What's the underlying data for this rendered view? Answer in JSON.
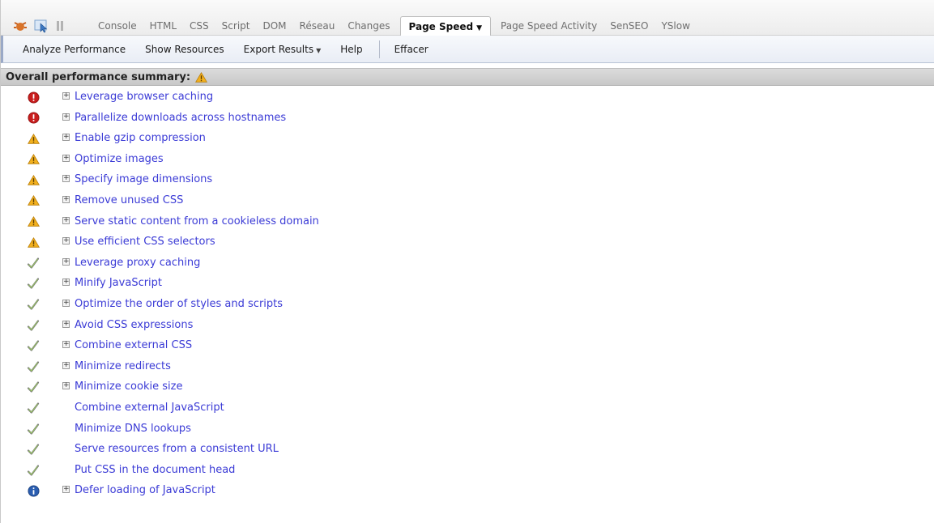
{
  "toolbar_tabs": {
    "tabs": [
      {
        "label": "Console",
        "active": false
      },
      {
        "label": "HTML",
        "active": false
      },
      {
        "label": "CSS",
        "active": false
      },
      {
        "label": "Script",
        "active": false
      },
      {
        "label": "DOM",
        "active": false
      },
      {
        "label": "Réseau",
        "active": false
      },
      {
        "label": "Changes",
        "active": false
      },
      {
        "label": "Page Speed",
        "active": true
      },
      {
        "label": "Page Speed Activity",
        "active": false
      },
      {
        "label": "SenSEO",
        "active": false
      },
      {
        "label": "YSlow",
        "active": false
      }
    ]
  },
  "actions": {
    "analyze": "Analyze Performance",
    "show_resources": "Show Resources",
    "export_results": "Export Results",
    "help": "Help",
    "clear": "Effacer"
  },
  "summary": {
    "label": "Overall performance summary:",
    "status_icon": "warning-icon"
  },
  "colors": {
    "link": "#3b3bd6",
    "error": "#c81d1d",
    "warning": "#e8a317",
    "pass": "#6b6b6b",
    "info": "#2a5db0"
  },
  "rules": [
    {
      "label": "Leverage browser caching",
      "status": "error",
      "expandable": true
    },
    {
      "label": "Parallelize downloads across hostnames",
      "status": "error",
      "expandable": true
    },
    {
      "label": "Enable gzip compression",
      "status": "warning",
      "expandable": true
    },
    {
      "label": "Optimize images",
      "status": "warning",
      "expandable": true
    },
    {
      "label": "Specify image dimensions",
      "status": "warning",
      "expandable": true
    },
    {
      "label": "Remove unused CSS",
      "status": "warning",
      "expandable": true
    },
    {
      "label": "Serve static content from a cookieless domain",
      "status": "warning",
      "expandable": true
    },
    {
      "label": "Use efficient CSS selectors",
      "status": "warning",
      "expandable": true
    },
    {
      "label": "Leverage proxy caching",
      "status": "pass",
      "expandable": true
    },
    {
      "label": "Minify JavaScript",
      "status": "pass",
      "expandable": true
    },
    {
      "label": "Optimize the order of styles and scripts",
      "status": "pass",
      "expandable": true
    },
    {
      "label": "Avoid CSS expressions",
      "status": "pass",
      "expandable": true
    },
    {
      "label": "Combine external CSS",
      "status": "pass",
      "expandable": true
    },
    {
      "label": "Minimize redirects",
      "status": "pass",
      "expandable": true
    },
    {
      "label": "Minimize cookie size",
      "status": "pass",
      "expandable": true
    },
    {
      "label": "Combine external JavaScript",
      "status": "pass",
      "expandable": false
    },
    {
      "label": "Minimize DNS lookups",
      "status": "pass",
      "expandable": false
    },
    {
      "label": "Serve resources from a consistent URL",
      "status": "pass",
      "expandable": false
    },
    {
      "label": "Put CSS in the document head",
      "status": "pass",
      "expandable": false
    },
    {
      "label": "Defer loading of JavaScript",
      "status": "info",
      "expandable": true
    }
  ]
}
